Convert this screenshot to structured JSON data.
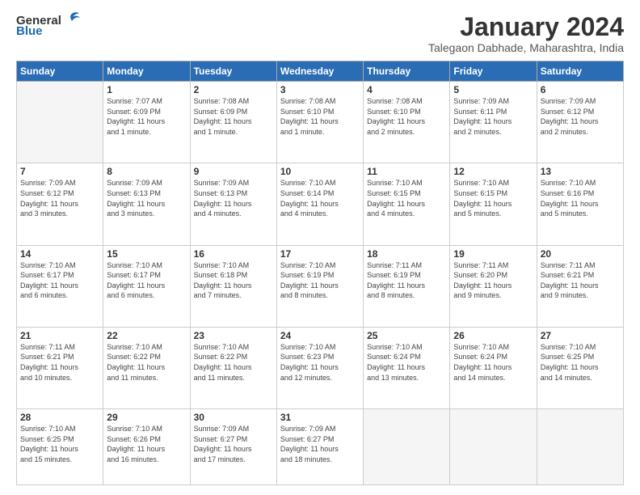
{
  "logo": {
    "general": "General",
    "blue": "Blue"
  },
  "header": {
    "month": "January 2024",
    "location": "Talegaon Dabhade, Maharashtra, India"
  },
  "weekdays": [
    "Sunday",
    "Monday",
    "Tuesday",
    "Wednesday",
    "Thursday",
    "Friday",
    "Saturday"
  ],
  "weeks": [
    [
      {
        "day": "",
        "info": ""
      },
      {
        "day": "1",
        "info": "Sunrise: 7:07 AM\nSunset: 6:09 PM\nDaylight: 11 hours\nand 1 minute."
      },
      {
        "day": "2",
        "info": "Sunrise: 7:08 AM\nSunset: 6:09 PM\nDaylight: 11 hours\nand 1 minute."
      },
      {
        "day": "3",
        "info": "Sunrise: 7:08 AM\nSunset: 6:10 PM\nDaylight: 11 hours\nand 1 minute."
      },
      {
        "day": "4",
        "info": "Sunrise: 7:08 AM\nSunset: 6:10 PM\nDaylight: 11 hours\nand 2 minutes."
      },
      {
        "day": "5",
        "info": "Sunrise: 7:09 AM\nSunset: 6:11 PM\nDaylight: 11 hours\nand 2 minutes."
      },
      {
        "day": "6",
        "info": "Sunrise: 7:09 AM\nSunset: 6:12 PM\nDaylight: 11 hours\nand 2 minutes."
      }
    ],
    [
      {
        "day": "7",
        "info": "Sunrise: 7:09 AM\nSunset: 6:12 PM\nDaylight: 11 hours\nand 3 minutes."
      },
      {
        "day": "8",
        "info": "Sunrise: 7:09 AM\nSunset: 6:13 PM\nDaylight: 11 hours\nand 3 minutes."
      },
      {
        "day": "9",
        "info": "Sunrise: 7:09 AM\nSunset: 6:13 PM\nDaylight: 11 hours\nand 4 minutes."
      },
      {
        "day": "10",
        "info": "Sunrise: 7:10 AM\nSunset: 6:14 PM\nDaylight: 11 hours\nand 4 minutes."
      },
      {
        "day": "11",
        "info": "Sunrise: 7:10 AM\nSunset: 6:15 PM\nDaylight: 11 hours\nand 4 minutes."
      },
      {
        "day": "12",
        "info": "Sunrise: 7:10 AM\nSunset: 6:15 PM\nDaylight: 11 hours\nand 5 minutes."
      },
      {
        "day": "13",
        "info": "Sunrise: 7:10 AM\nSunset: 6:16 PM\nDaylight: 11 hours\nand 5 minutes."
      }
    ],
    [
      {
        "day": "14",
        "info": "Sunrise: 7:10 AM\nSunset: 6:17 PM\nDaylight: 11 hours\nand 6 minutes."
      },
      {
        "day": "15",
        "info": "Sunrise: 7:10 AM\nSunset: 6:17 PM\nDaylight: 11 hours\nand 6 minutes."
      },
      {
        "day": "16",
        "info": "Sunrise: 7:10 AM\nSunset: 6:18 PM\nDaylight: 11 hours\nand 7 minutes."
      },
      {
        "day": "17",
        "info": "Sunrise: 7:10 AM\nSunset: 6:19 PM\nDaylight: 11 hours\nand 8 minutes."
      },
      {
        "day": "18",
        "info": "Sunrise: 7:11 AM\nSunset: 6:19 PM\nDaylight: 11 hours\nand 8 minutes."
      },
      {
        "day": "19",
        "info": "Sunrise: 7:11 AM\nSunset: 6:20 PM\nDaylight: 11 hours\nand 9 minutes."
      },
      {
        "day": "20",
        "info": "Sunrise: 7:11 AM\nSunset: 6:21 PM\nDaylight: 11 hours\nand 9 minutes."
      }
    ],
    [
      {
        "day": "21",
        "info": "Sunrise: 7:11 AM\nSunset: 6:21 PM\nDaylight: 11 hours\nand 10 minutes."
      },
      {
        "day": "22",
        "info": "Sunrise: 7:10 AM\nSunset: 6:22 PM\nDaylight: 11 hours\nand 11 minutes."
      },
      {
        "day": "23",
        "info": "Sunrise: 7:10 AM\nSunset: 6:22 PM\nDaylight: 11 hours\nand 11 minutes."
      },
      {
        "day": "24",
        "info": "Sunrise: 7:10 AM\nSunset: 6:23 PM\nDaylight: 11 hours\nand 12 minutes."
      },
      {
        "day": "25",
        "info": "Sunrise: 7:10 AM\nSunset: 6:24 PM\nDaylight: 11 hours\nand 13 minutes."
      },
      {
        "day": "26",
        "info": "Sunrise: 7:10 AM\nSunset: 6:24 PM\nDaylight: 11 hours\nand 14 minutes."
      },
      {
        "day": "27",
        "info": "Sunrise: 7:10 AM\nSunset: 6:25 PM\nDaylight: 11 hours\nand 14 minutes."
      }
    ],
    [
      {
        "day": "28",
        "info": "Sunrise: 7:10 AM\nSunset: 6:25 PM\nDaylight: 11 hours\nand 15 minutes."
      },
      {
        "day": "29",
        "info": "Sunrise: 7:10 AM\nSunset: 6:26 PM\nDaylight: 11 hours\nand 16 minutes."
      },
      {
        "day": "30",
        "info": "Sunrise: 7:09 AM\nSunset: 6:27 PM\nDaylight: 11 hours\nand 17 minutes."
      },
      {
        "day": "31",
        "info": "Sunrise: 7:09 AM\nSunset: 6:27 PM\nDaylight: 11 hours\nand 18 minutes."
      },
      {
        "day": "",
        "info": ""
      },
      {
        "day": "",
        "info": ""
      },
      {
        "day": "",
        "info": ""
      }
    ]
  ]
}
